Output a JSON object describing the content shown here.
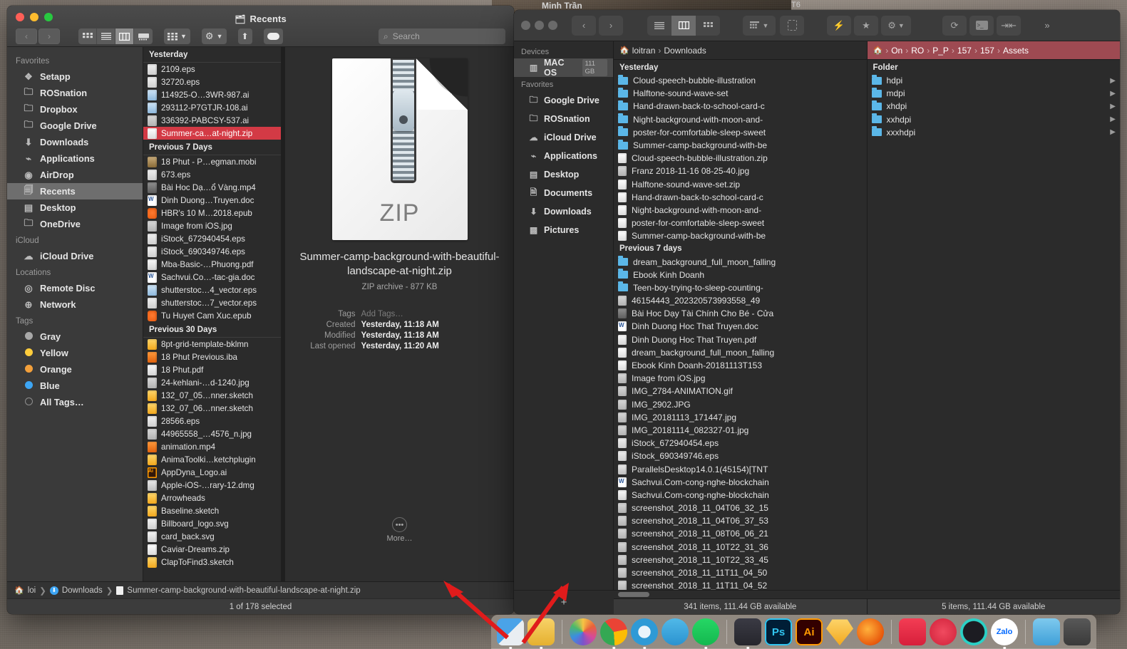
{
  "finder": {
    "title": "Recents",
    "title_icon": "recents-icon",
    "nav": {
      "back": "‹",
      "forward": "›"
    },
    "view_modes": [
      "icon-view",
      "list-view",
      "column-view",
      "gallery-view"
    ],
    "active_view": "column-view",
    "toolbar_buttons": [
      "arrange-button",
      "action-button",
      "share-button",
      "tags-button"
    ],
    "search": {
      "placeholder": "Search",
      "value": ""
    },
    "sidebar": [
      {
        "header": "Favorites",
        "items": [
          {
            "label": "Setapp",
            "icon": "setapp-icon"
          },
          {
            "label": "ROSnation",
            "icon": "folder-icon"
          },
          {
            "label": "Dropbox",
            "icon": "folder-icon"
          },
          {
            "label": "Google Drive",
            "icon": "folder-icon"
          },
          {
            "label": "Downloads",
            "icon": "downloads-icon"
          },
          {
            "label": "Applications",
            "icon": "applications-icon"
          },
          {
            "label": "AirDrop",
            "icon": "airdrop-icon"
          },
          {
            "label": "Recents",
            "icon": "recents-icon",
            "selected": true
          },
          {
            "label": "Desktop",
            "icon": "desktop-icon"
          },
          {
            "label": "OneDrive",
            "icon": "folder-icon"
          }
        ]
      },
      {
        "header": "iCloud",
        "items": [
          {
            "label": "iCloud Drive",
            "icon": "cloud-icon"
          }
        ]
      },
      {
        "header": "Locations",
        "items": [
          {
            "label": "Remote Disc",
            "icon": "disc-icon"
          },
          {
            "label": "Network",
            "icon": "network-icon"
          }
        ]
      },
      {
        "header": "Tags",
        "items": [
          {
            "label": "Gray",
            "icon": "tag-dot",
            "color": "#a8a8a8"
          },
          {
            "label": "Yellow",
            "icon": "tag-dot",
            "color": "#ffcd3c"
          },
          {
            "label": "Orange",
            "icon": "tag-dot",
            "color": "#f3a03b"
          },
          {
            "label": "Blue",
            "icon": "tag-dot",
            "color": "#3da5f4"
          },
          {
            "label": "All Tags…",
            "icon": "tag-dot-outline",
            "color": "transparent"
          }
        ]
      }
    ],
    "columns": [
      {
        "group": "Yesterday",
        "files": [
          {
            "name": "2109.eps",
            "kind": "eps"
          },
          {
            "name": "32720.eps",
            "kind": "eps"
          },
          {
            "name": "114925-O…3WR-987.ai",
            "kind": "blue"
          },
          {
            "name": "293112-P7GTJR-108.ai",
            "kind": "blue"
          },
          {
            "name": "336392-PABCSY-537.ai",
            "kind": "img"
          },
          {
            "name": "Summer-ca…at-night.zip",
            "kind": "zip",
            "selected": true
          }
        ]
      },
      {
        "group": "Previous 7 Days",
        "files": [
          {
            "name": "18 Phut - P…egman.mobi",
            "kind": "mobi"
          },
          {
            "name": "673.eps",
            "kind": "eps"
          },
          {
            "name": "Bài Hoc Dạ…ổ Vàng.mp4",
            "kind": "mp4"
          },
          {
            "name": "Dinh Duong…Truyen.doc",
            "kind": "word"
          },
          {
            "name": "HBR's 10 M…2018.epub",
            "kind": "epub"
          },
          {
            "name": "Image from iOS.jpg",
            "kind": "img"
          },
          {
            "name": "iStock_672940454.eps",
            "kind": "eps"
          },
          {
            "name": "iStock_690349746.eps",
            "kind": "eps"
          },
          {
            "name": "Mba-Basic-…Phuong.pdf",
            "kind": "pdf"
          },
          {
            "name": "Sachvui.Co…-tac-gia.doc",
            "kind": "word"
          },
          {
            "name": "shutterstoc…4_vector.eps",
            "kind": "blue"
          },
          {
            "name": "shutterstoc…7_vector.eps",
            "kind": "eps"
          },
          {
            "name": "Tu Huyet Cam Xuc.epub",
            "kind": "epub"
          }
        ]
      },
      {
        "group": "Previous 30 Days",
        "files": [
          {
            "name": "8pt-grid-template-bklmn",
            "kind": "sketch"
          },
          {
            "name": "18 Phut Previous.iba",
            "kind": "iba"
          },
          {
            "name": "18 Phut.pdf",
            "kind": "pdf"
          },
          {
            "name": "24-kehlani-…d-1240.jpg",
            "kind": "img"
          },
          {
            "name": "132_07_05…nner.sketch",
            "kind": "sketch"
          },
          {
            "name": "132_07_06…nner.sketch",
            "kind": "sketch"
          },
          {
            "name": "28566.eps",
            "kind": "eps"
          },
          {
            "name": "44965558_…4576_n.jpg",
            "kind": "img"
          },
          {
            "name": "animation.mp4",
            "kind": "iba"
          },
          {
            "name": "AnimaToolki…ketchplugin",
            "kind": "sketch"
          },
          {
            "name": "AppDyna_Logo.ai",
            "kind": "ai"
          },
          {
            "name": "Apple-iOS-…rary-12.dmg",
            "kind": "dmg"
          },
          {
            "name": "Arrowheads",
            "kind": "sketch"
          },
          {
            "name": "Baseline.sketch",
            "kind": "sketch"
          },
          {
            "name": "Billboard_logo.svg",
            "kind": "svg"
          },
          {
            "name": "card_back.svg",
            "kind": "svg"
          },
          {
            "name": "Caviar-Dreams.zip",
            "kind": "zip"
          },
          {
            "name": "ClapToFind3.sketch",
            "kind": "sketch"
          }
        ]
      }
    ],
    "preview": {
      "icon_label": "ZIP",
      "filename": "Summer-camp-background-with-beautiful-landscape-at-night.zip",
      "kind_size": "ZIP archive - 877 KB",
      "meta": [
        {
          "label": "Tags",
          "value": "Add Tags…",
          "placeholder": true
        },
        {
          "label": "Created",
          "value": "Yesterday, 11:18 AM"
        },
        {
          "label": "Modified",
          "value": "Yesterday, 11:18 AM"
        },
        {
          "label": "Last opened",
          "value": "Yesterday, 11:20 AM"
        }
      ],
      "more_label": "More…"
    },
    "pathbar": [
      "loi",
      "Downloads",
      "Summer-camp-background-with-beautiful-landscape-at-night.zip"
    ],
    "status": "1 of 178 selected"
  },
  "rwin": {
    "toolbar": {
      "view_modes": [
        "list-view",
        "brief-view",
        "icon-view"
      ],
      "active_view": "brief-view",
      "buttons": [
        "sort-button",
        "selection-button",
        "quick-access-button",
        "bookmark-button",
        "settings-button",
        "refresh-button",
        "terminal-button",
        "compare-button",
        "overflow-button"
      ]
    },
    "sidebar": [
      {
        "header": "Devices",
        "items": [
          {
            "label": "MAC OS",
            "icon": "drive-icon",
            "badge": "111 GB",
            "selected": true
          }
        ]
      },
      {
        "header": "Favorites",
        "items": [
          {
            "label": "Google Drive",
            "icon": "folder-icon"
          },
          {
            "label": "ROSnation",
            "icon": "folder-icon"
          },
          {
            "label": "iCloud Drive",
            "icon": "cloud-icon"
          },
          {
            "label": "Applications",
            "icon": "applications-icon"
          },
          {
            "label": "Desktop",
            "icon": "desktop-icon"
          },
          {
            "label": "Documents",
            "icon": "documents-icon"
          },
          {
            "label": "Downloads",
            "icon": "downloads-icon"
          },
          {
            "label": "Pictures",
            "icon": "pictures-icon"
          }
        ]
      }
    ],
    "pane_left": {
      "crumb": [
        "loitran",
        "Downloads"
      ],
      "active": false,
      "groups": [
        {
          "title": "Yesterday",
          "files": [
            {
              "name": "Cloud-speech-bubble-illustration",
              "kind": "folder"
            },
            {
              "name": "Halftone-sound-wave-set",
              "kind": "folder"
            },
            {
              "name": "Hand-drawn-back-to-school-card-c",
              "kind": "folder"
            },
            {
              "name": "Night-background-with-moon-and-",
              "kind": "folder"
            },
            {
              "name": "poster-for-comfortable-sleep-sweet",
              "kind": "folder"
            },
            {
              "name": "Summer-camp-background-with-be",
              "kind": "folder"
            },
            {
              "name": "Cloud-speech-bubble-illustration.zip",
              "kind": "zip"
            },
            {
              "name": "Franz 2018-11-16 08-25-40.jpg",
              "kind": "img"
            },
            {
              "name": "Halftone-sound-wave-set.zip",
              "kind": "zip"
            },
            {
              "name": "Hand-drawn-back-to-school-card-c",
              "kind": "zip"
            },
            {
              "name": "Night-background-with-moon-and-",
              "kind": "zip"
            },
            {
              "name": "poster-for-comfortable-sleep-sweet",
              "kind": "zip"
            },
            {
              "name": "Summer-camp-background-with-be",
              "kind": "zip"
            }
          ]
        },
        {
          "title": "Previous 7 days",
          "files": [
            {
              "name": "dream_background_full_moon_falling",
              "kind": "folder"
            },
            {
              "name": "Ebook Kinh Doanh",
              "kind": "folder"
            },
            {
              "name": "Teen-boy-trying-to-sleep-counting-",
              "kind": "folder"
            },
            {
              "name": "46154443_202320573993558_49",
              "kind": "img"
            },
            {
              "name": "Bài Hoc Dạy Tài Chính Cho Bé - Cửa",
              "kind": "mp4"
            },
            {
              "name": "Dinh Duong Hoc That Truyen.doc",
              "kind": "word"
            },
            {
              "name": "Dinh Duong Hoc That Truyen.pdf",
              "kind": "pdf"
            },
            {
              "name": "dream_background_full_moon_falling",
              "kind": "zip"
            },
            {
              "name": "Ebook Kinh Doanh-20181113T153",
              "kind": "zip"
            },
            {
              "name": "Image from iOS.jpg",
              "kind": "img"
            },
            {
              "name": "IMG_2784-ANIMATION.gif",
              "kind": "img"
            },
            {
              "name": "IMG_2902.JPG",
              "kind": "img"
            },
            {
              "name": "IMG_20181113_171447.jpg",
              "kind": "img"
            },
            {
              "name": "IMG_20181114_082327-01.jpg",
              "kind": "img"
            },
            {
              "name": "iStock_672940454.eps",
              "kind": "eps"
            },
            {
              "name": "iStock_690349746.eps",
              "kind": "eps"
            },
            {
              "name": "ParallelsDesktop14.0.1(45154)[TNT",
              "kind": "dmg"
            },
            {
              "name": "Sachvui.Com-cong-nghe-blockchain",
              "kind": "word"
            },
            {
              "name": "Sachvui.Com-cong-nghe-blockchain",
              "kind": "pdf"
            },
            {
              "name": "screenshot_2018_11_04T06_32_15",
              "kind": "img"
            },
            {
              "name": "screenshot_2018_11_04T06_37_53",
              "kind": "img"
            },
            {
              "name": "screenshot_2018_11_08T06_06_21",
              "kind": "img"
            },
            {
              "name": "screenshot_2018_11_10T22_31_36",
              "kind": "img"
            },
            {
              "name": "screenshot_2018_11_10T22_33_45",
              "kind": "img"
            },
            {
              "name": "screenshot_2018_11_11T11_04_50",
              "kind": "img"
            },
            {
              "name": "screenshot_2018_11_11T11_04_52",
              "kind": "img"
            }
          ]
        }
      ],
      "status": "341 items, 111.44 GB available"
    },
    "pane_right": {
      "crumb": [
        "On",
        "RO",
        "P_P",
        "157",
        "157",
        "Assets"
      ],
      "active": true,
      "groups": [
        {
          "title": "Folder",
          "files": [
            {
              "name": "hdpi",
              "kind": "folder",
              "expandable": true
            },
            {
              "name": "mdpi",
              "kind": "folder",
              "expandable": true
            },
            {
              "name": "xhdpi",
              "kind": "folder",
              "expandable": true
            },
            {
              "name": "xxhdpi",
              "kind": "folder",
              "expandable": true
            },
            {
              "name": "xxxhdpi",
              "kind": "folder",
              "expandable": true
            }
          ]
        }
      ],
      "status": "5 items, 111.44 GB available"
    },
    "add_tab_label": "+"
  },
  "dock": {
    "apps": [
      {
        "name": "finder",
        "label": "",
        "running": true
      },
      {
        "name": "commander-one",
        "label": "",
        "running": true
      },
      {
        "name": "photos",
        "label": "",
        "running": false
      },
      {
        "name": "chrome",
        "label": "",
        "running": true
      },
      {
        "name": "safari-tech",
        "label": "",
        "running": true
      },
      {
        "name": "telegram",
        "label": "",
        "running": false
      },
      {
        "name": "spotify",
        "label": "",
        "running": true
      },
      {
        "name": "figma",
        "label": "",
        "running": true
      },
      {
        "name": "photoshop",
        "label": "Ps",
        "running": false
      },
      {
        "name": "illustrator",
        "label": "Ai",
        "running": false
      },
      {
        "name": "sketch",
        "label": "",
        "running": false
      },
      {
        "name": "firefox",
        "label": "",
        "running": false
      },
      {
        "name": "xmind",
        "label": "",
        "running": false
      },
      {
        "name": "mindnode",
        "label": "",
        "running": false
      },
      {
        "name": "audio-app",
        "label": "",
        "running": false
      },
      {
        "name": "zalo",
        "label": "Zalo",
        "running": true
      },
      {
        "name": "downloads-stack",
        "label": "",
        "running": false
      },
      {
        "name": "trash",
        "label": "",
        "running": false
      }
    ]
  },
  "desktop": {
    "menu_user": "Minh Trần",
    "menu_extra": "T6"
  }
}
